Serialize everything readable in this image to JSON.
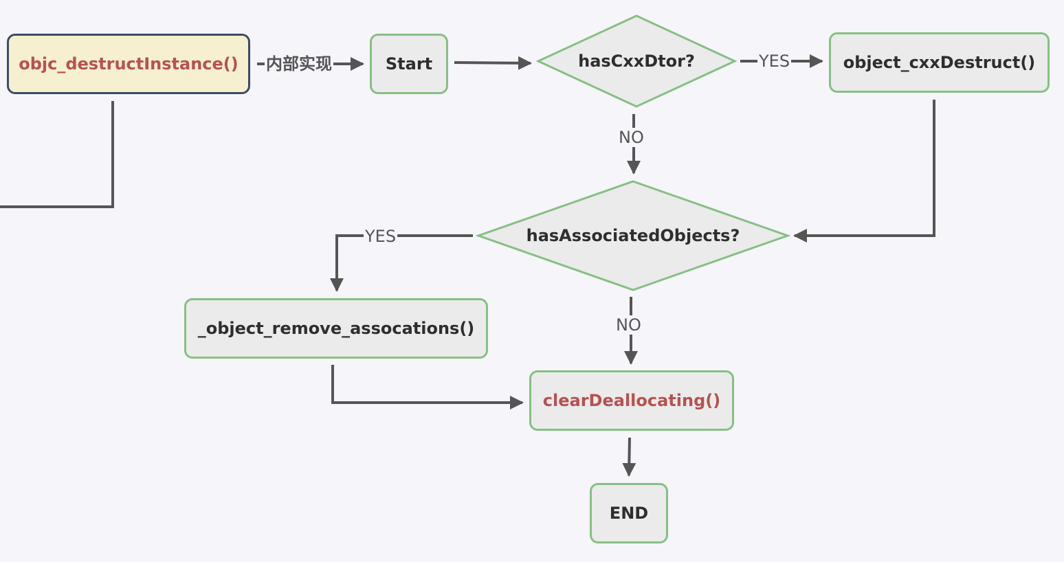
{
  "nodes": {
    "entry": "objc_destructInstance()",
    "start": "Start",
    "has_cxx_dtor": "hasCxxDtor?",
    "cxx_destruct": "object_cxxDestruct()",
    "has_associated": "hasAssociatedObjects?",
    "remove_assoc": "_object_remove_assocations()",
    "clear_dealloc": "clearDeallocating()",
    "end": "END"
  },
  "edge_labels": {
    "impl": "内部实现",
    "cxx_yes": "YES",
    "cxx_no": "NO",
    "assoc_yes": "YES",
    "assoc_no": "NO"
  },
  "colors": {
    "background": "#f5f5fa",
    "node_fill": "#ebebeb",
    "node_border": "#86c083",
    "entry_fill": "#f6f0d0",
    "entry_border": "#3d4b66",
    "highlight_text": "#b85151",
    "edge": "#555555"
  }
}
